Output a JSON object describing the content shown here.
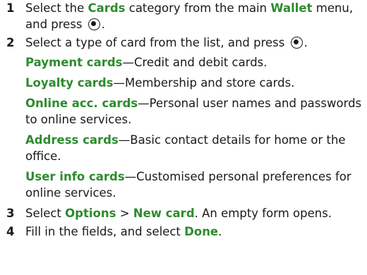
{
  "steps": [
    {
      "num": "1",
      "parts": [
        {
          "t": "Select the "
        },
        {
          "t": "Cards",
          "hl": true
        },
        {
          "t": " category from the main "
        },
        {
          "t": "Wallet",
          "hl": true
        },
        {
          "t": " menu, and press "
        },
        {
          "icon": "joystick-select-icon"
        },
        {
          "t": "."
        }
      ]
    },
    {
      "num": "2",
      "parts": [
        {
          "t": "Select a type of card from the list, and press "
        },
        {
          "icon": "joystick-select-icon"
        },
        {
          "t": "."
        }
      ],
      "sub": [
        {
          "term": "Payment cards",
          "desc": "—Credit and debit cards."
        },
        {
          "term": "Loyalty cards",
          "desc": "—Membership and store cards."
        },
        {
          "term": "Online acc. cards",
          "desc": "—Personal user names and passwords to online services."
        },
        {
          "term": "Address cards",
          "desc": "—Basic contact details for home or the office."
        },
        {
          "term": "User info cards",
          "desc": "—Customised personal preferences for online services."
        }
      ]
    },
    {
      "num": "3",
      "parts": [
        {
          "t": "Select "
        },
        {
          "t": "Options",
          "hl": true
        },
        {
          "t": " > "
        },
        {
          "t": "New card",
          "hl": true
        },
        {
          "t": ". An empty form opens."
        }
      ]
    },
    {
      "num": "4",
      "parts": [
        {
          "t": "Fill in the fields, and select "
        },
        {
          "t": "Done",
          "hl": true
        },
        {
          "t": "."
        }
      ]
    }
  ]
}
